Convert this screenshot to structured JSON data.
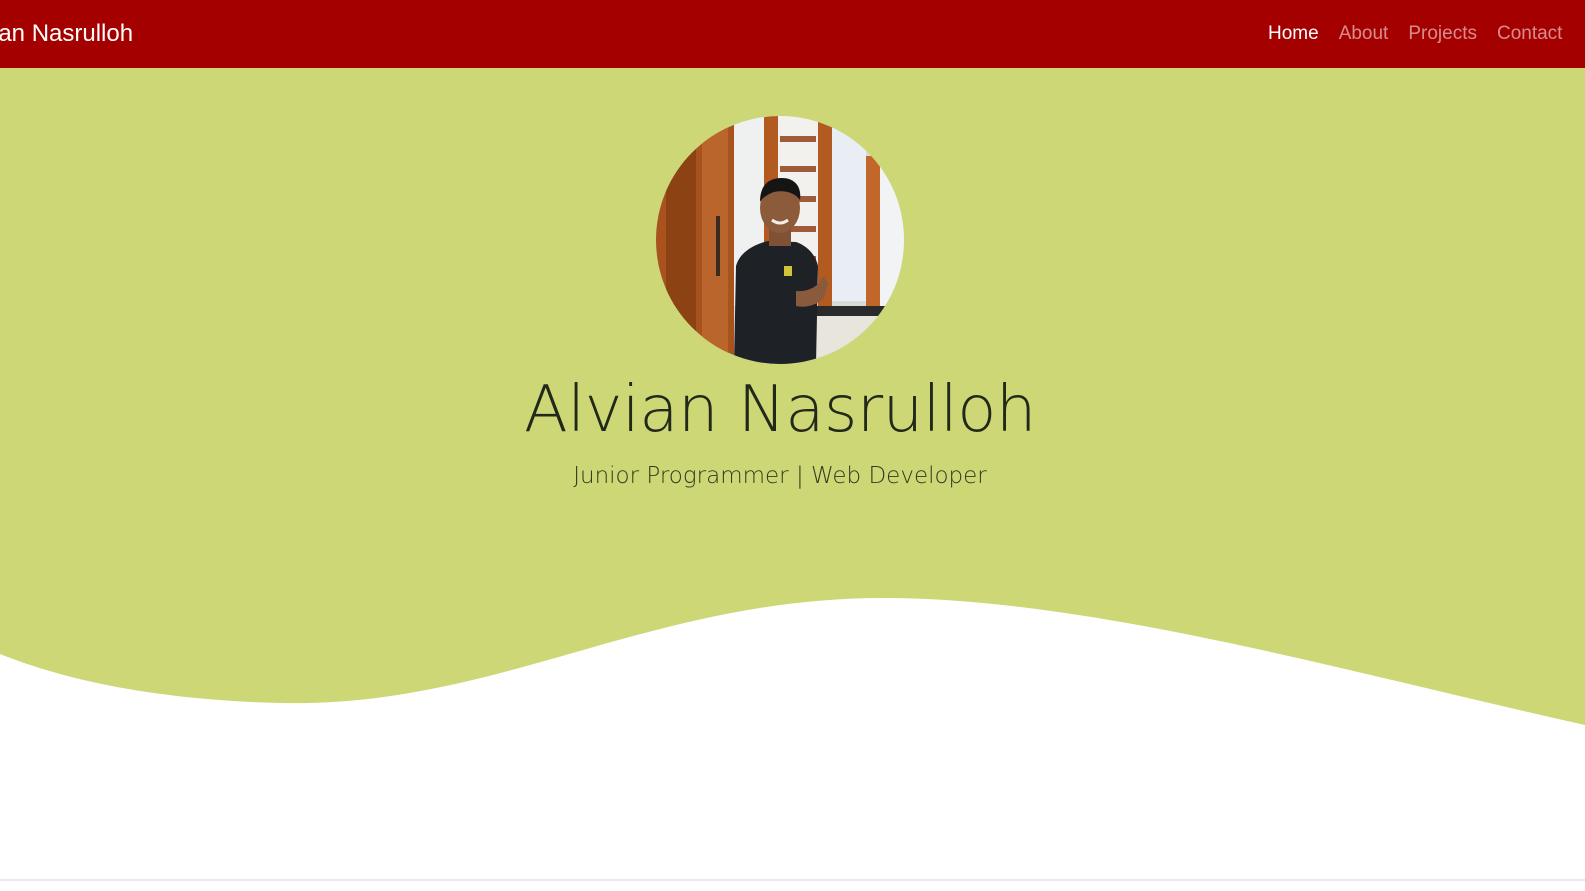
{
  "navbar": {
    "brand": "vian Nasrulloh",
    "links": [
      {
        "label": "Home",
        "active": true
      },
      {
        "label": "About",
        "active": false
      },
      {
        "label": "Projects",
        "active": false
      },
      {
        "label": "Contact",
        "active": false
      }
    ]
  },
  "hero": {
    "avatar_icon": "profile-photo",
    "name": "Alvian Nasrulloh",
    "subtitle": "Junior Programmer | Web Developer"
  },
  "colors": {
    "navbar_bg": "#a50000",
    "hero_bg": "#cdd775",
    "page_bg": "#ffffff",
    "text_dark": "#23291a"
  }
}
